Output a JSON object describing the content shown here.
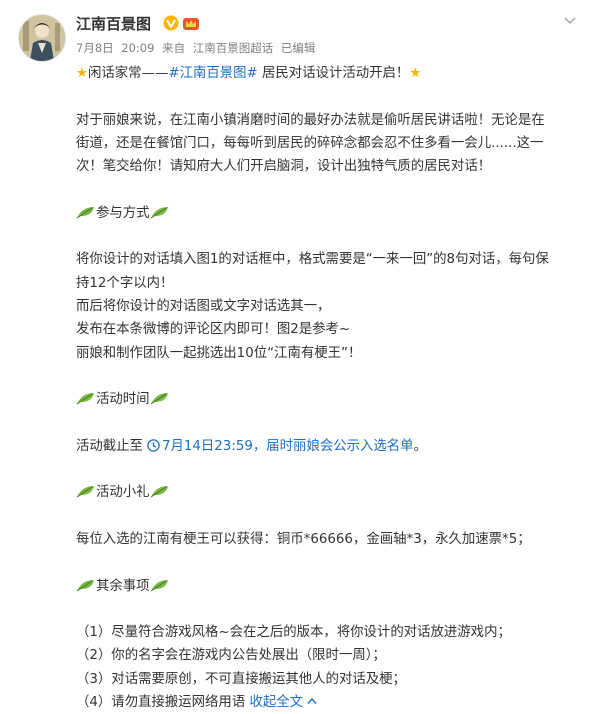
{
  "post": {
    "author": "江南百景图",
    "date": "7月8日",
    "time": "20:09",
    "source_prefix": "来自",
    "source": "江南百景图超话",
    "edited": "已编辑",
    "title_prefix": "闲话家常——",
    "title_tag": "#江南百景图#",
    "title_suffix": " 居民对话设计活动开启！",
    "intro": [
      "对于丽娘来说，在江南小镇消磨时间的最好办法就是偷听居民讲话啦！无论是在",
      "街道，还是在餐馆门口，每每听到居民的碎碎念都会忍不住多看一会儿......这一",
      "次！笔交给你！请知府大人们开启脑洞，设计出独特气质的居民对话！"
    ],
    "section1_heading": "参与方式",
    "section1_lines": [
      "将你设计的对话填入图1的对话框中，格式需要是“一来一回”的8句对话，每句保",
      "持12个字以内！",
      "而后将你设计的对话图或文字对话选其一，",
      "发布在本条微博的评论区内即可！图2是参考~",
      "丽娘和制作团队一起挑选出10位“江南有梗王”！"
    ],
    "section2_heading": "活动时间",
    "deadline_prefix": "活动截止至",
    "deadline_link": "7月14日23:59，届时丽娘会公示入选名单",
    "deadline_suffix": "。",
    "section3_heading": "活动小礼",
    "reward_line": "每位入选的江南有梗王可以获得：铜币*66666，金画轴*3，永久加速票*5；",
    "section4_heading": "其余事项",
    "notes": [
      "（1）尽量符合游戏风格~会在之后的版本，将你设计的对话放进游戏内；",
      "（2）你的名字会在游戏内公告处展出（限时一周）；",
      "（3）对话需要原创，不可直接搬运其他人的对话及梗；",
      "（4）请勿直接搬运网络用语"
    ],
    "collapse_label": "收起全文"
  },
  "colors": {
    "text": "#333333",
    "link": "#1e6fc2",
    "meta": "#808080",
    "star": "#f5b700",
    "leaf": "#5a9a2e"
  },
  "icons": [
    "avatar",
    "verified-v-icon",
    "vip-crown-icon",
    "chevron-down-icon",
    "star-icon",
    "leaf-icon",
    "clock-icon",
    "chevron-up-icon"
  ]
}
